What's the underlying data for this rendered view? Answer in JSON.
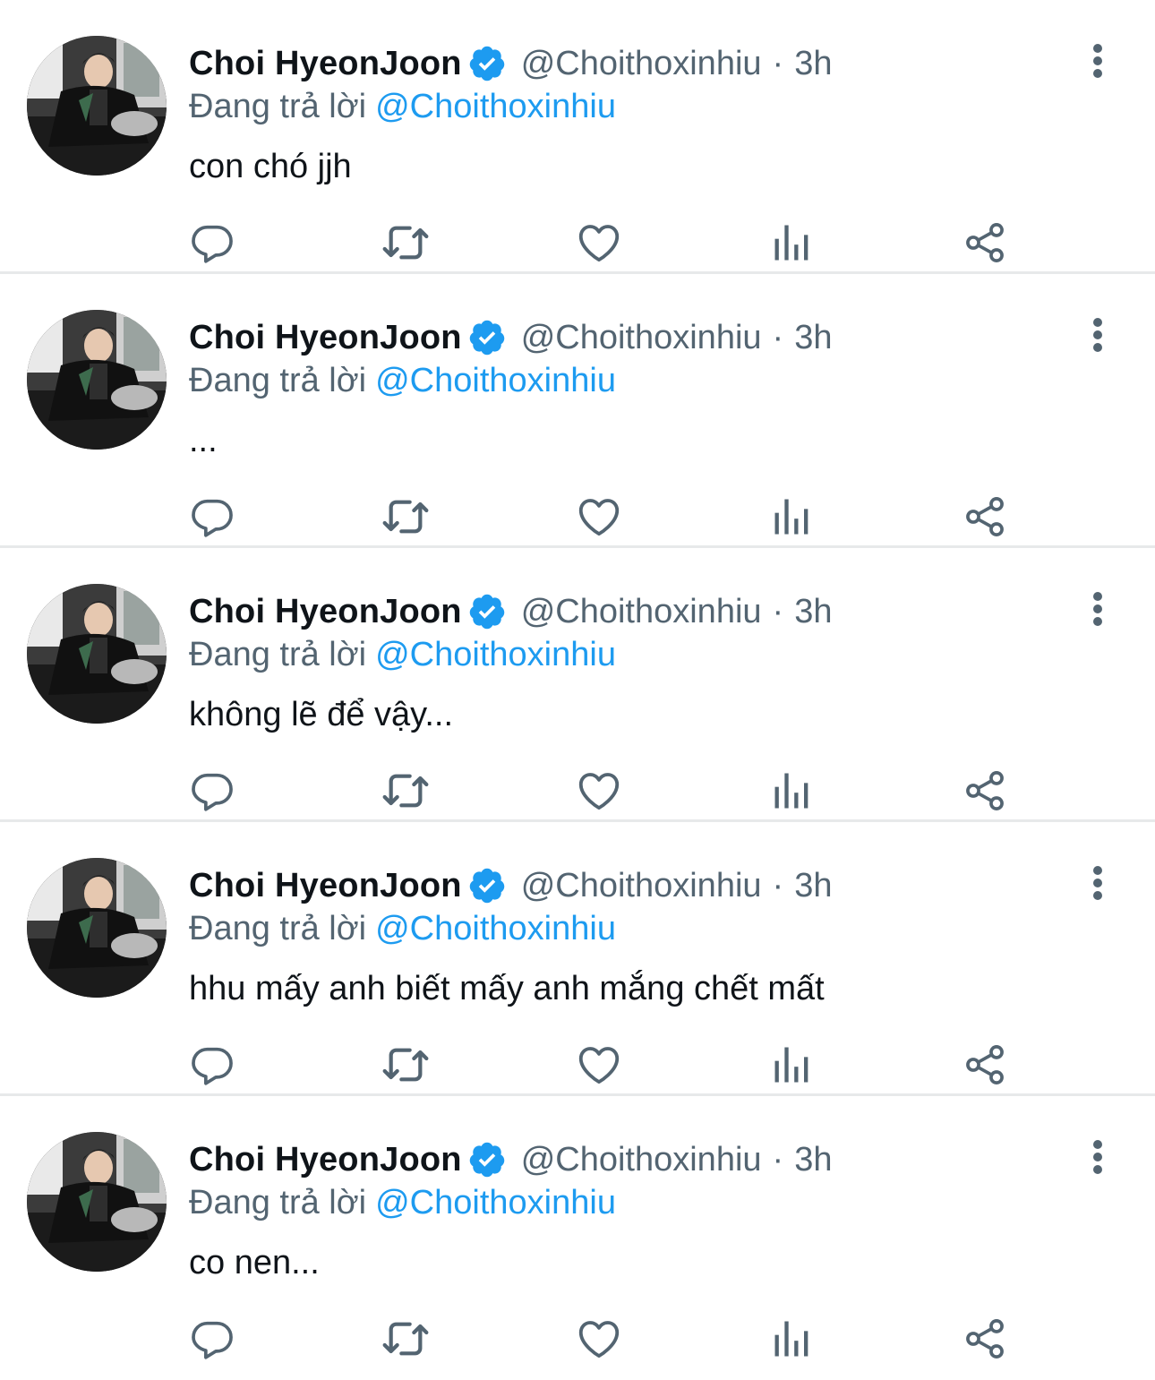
{
  "colors": {
    "accent": "#1d9bf0",
    "secondary_text": "#536471",
    "primary_text": "#0f1419",
    "divider": "#e7e9ea",
    "icon": "#536471"
  },
  "icons": {
    "verified": "verified-badge-icon",
    "more": "more-vertical-icon",
    "reply": "reply-icon",
    "retweet": "retweet-icon",
    "like": "heart-icon",
    "views": "views-chart-icon",
    "share": "share-icon"
  },
  "tweets": [
    {
      "display_name": "Choi HyeonJoon",
      "handle": "@Choithoxinhiu",
      "separator": "·",
      "time": "3h",
      "reply_prefix": "Đang trả lời",
      "reply_to": "@Choithoxinhiu",
      "text": "con chó jjh"
    },
    {
      "display_name": "Choi HyeonJoon",
      "handle": "@Choithoxinhiu",
      "separator": "·",
      "time": "3h",
      "reply_prefix": "Đang trả lời",
      "reply_to": "@Choithoxinhiu",
      "text": "..."
    },
    {
      "display_name": "Choi HyeonJoon",
      "handle": "@Choithoxinhiu",
      "separator": "·",
      "time": "3h",
      "reply_prefix": "Đang trả lời",
      "reply_to": "@Choithoxinhiu",
      "text": "không lẽ để vậy..."
    },
    {
      "display_name": "Choi HyeonJoon",
      "handle": "@Choithoxinhiu",
      "separator": "·",
      "time": "3h",
      "reply_prefix": "Đang trả lời",
      "reply_to": "@Choithoxinhiu",
      "text": "hhu mấy anh biết mấy anh mắng chết mất"
    },
    {
      "display_name": "Choi HyeonJoon",
      "handle": "@Choithoxinhiu",
      "separator": "·",
      "time": "3h",
      "reply_prefix": "Đang trả lời",
      "reply_to": "@Choithoxinhiu",
      "text": "co nen..."
    }
  ]
}
